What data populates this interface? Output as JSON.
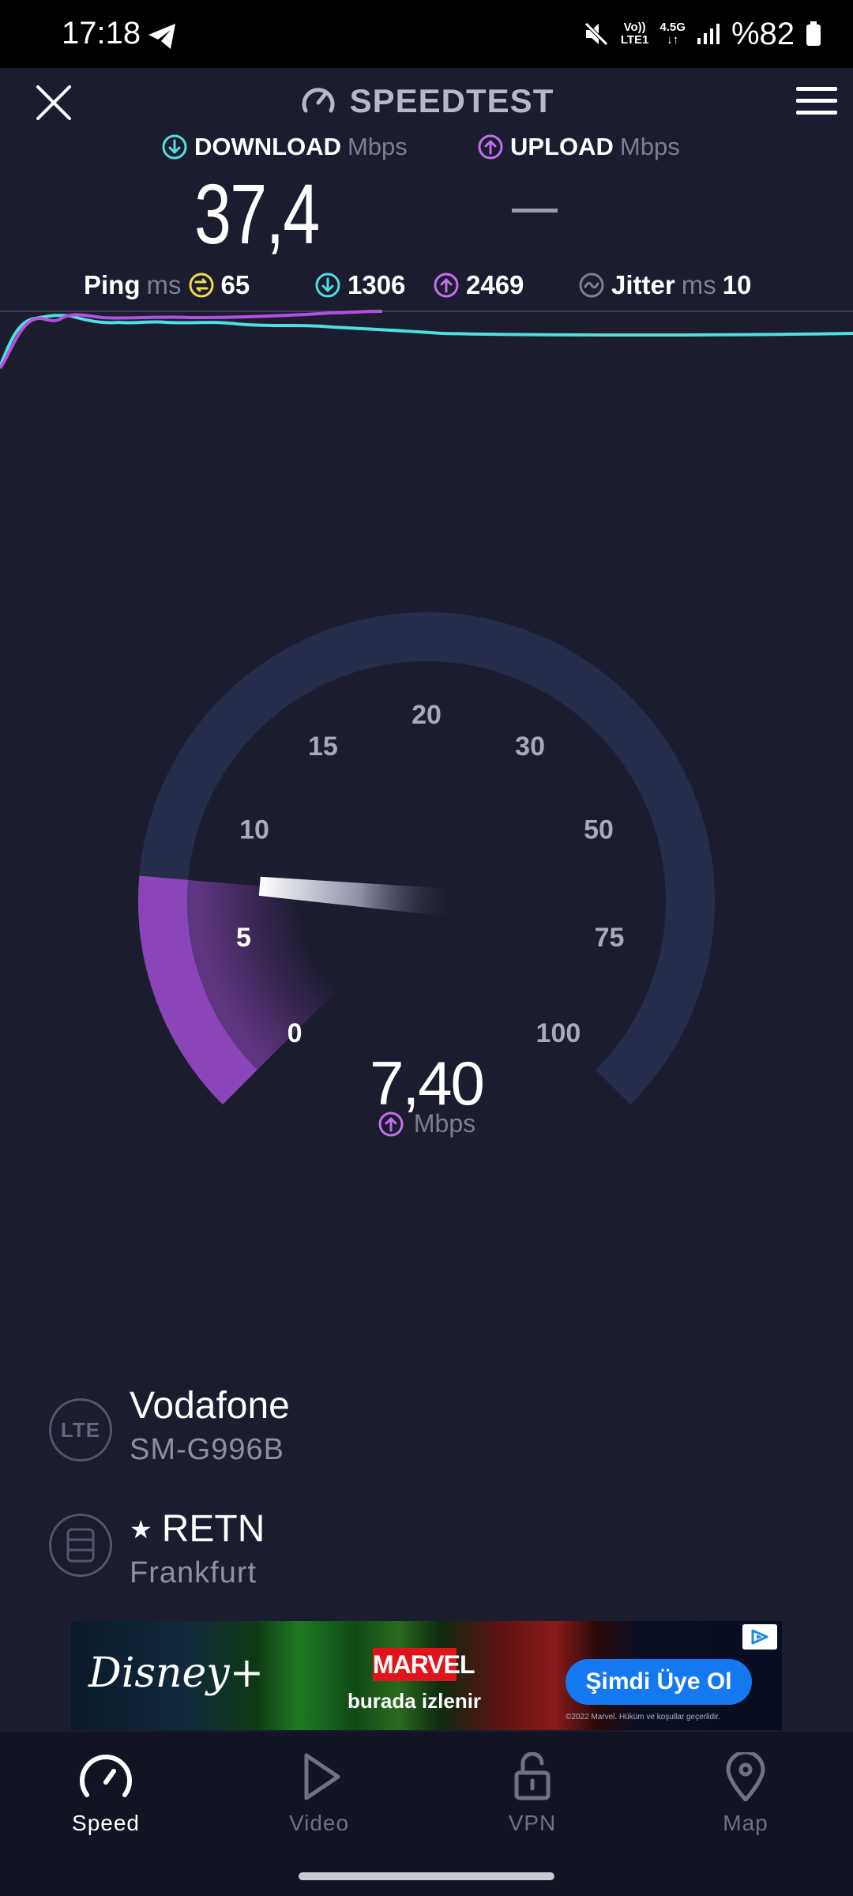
{
  "status_bar": {
    "time": "17:18",
    "network_top": "Vo))",
    "network_bottom": "LTE1",
    "network_type": "4.5G",
    "battery": "%82"
  },
  "header": {
    "title": "SPEEDTEST"
  },
  "metrics": {
    "download_label": "DOWNLOAD",
    "download_unit": "Mbps",
    "download_value": "37,4",
    "upload_label": "UPLOAD",
    "upload_unit": "Mbps"
  },
  "stats": {
    "ping_label": "Ping",
    "ping_unit": "ms",
    "ping_value": "65",
    "download_latency": "1306",
    "upload_latency": "2469",
    "jitter_label": "Jitter",
    "jitter_unit": "ms",
    "jitter_value": "10"
  },
  "gauge": {
    "ticks": [
      "0",
      "5",
      "10",
      "15",
      "20",
      "30",
      "50",
      "75",
      "100"
    ],
    "active_ticks": [
      "0",
      "5"
    ],
    "value": "7,40",
    "value_numeric": 7.4,
    "unit": "Mbps"
  },
  "provider": {
    "lte_badge": "LTE",
    "isp": "Vodafone",
    "device": "SM-G996B",
    "server_star": "★",
    "server": "RETN",
    "location": "Frankfurt"
  },
  "ad": {
    "brand": "Disney+",
    "marvel": "MARVEL",
    "tagline": "burada izlenir",
    "cta": "Şimdi Üye Ol",
    "fineprint": "©2022 Marvel. Hüküm ve koşullar geçerlidir."
  },
  "nav": {
    "items": [
      {
        "label": "Speed",
        "active": true
      },
      {
        "label": "Video",
        "active": false
      },
      {
        "label": "VPN",
        "active": false
      },
      {
        "label": "Map",
        "active": false
      }
    ]
  },
  "colors": {
    "background": "#1b1c2e",
    "download_accent": "#4ee0de",
    "upload_accent": "#c46ff0",
    "ping_accent": "#f3d94a",
    "gauge_track": "#262d4b",
    "gauge_fill": "#8a46b8"
  }
}
